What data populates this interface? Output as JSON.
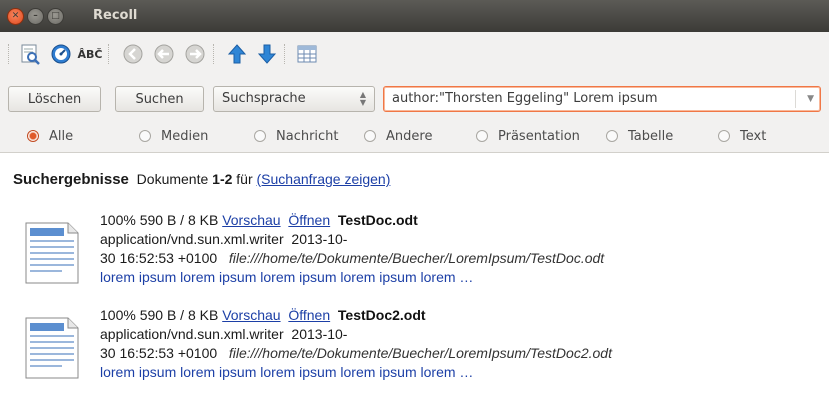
{
  "window": {
    "title": "Recoll"
  },
  "toolbar": {
    "icons": [
      "spell-check-icon",
      "query-icon",
      "ab-icon",
      "first-page-icon",
      "previous-page-icon",
      "next-page-icon",
      "sort-up-icon",
      "sort-down-icon",
      "table-view-icon"
    ],
    "abc_text": "ÂBČ"
  },
  "search": {
    "clear_label": "Löschen",
    "search_label": "Suchen",
    "language": "Suchsprache",
    "query": "author:\"Thorsten Eggeling\" Lorem ipsum"
  },
  "filters": [
    {
      "label": "Alle",
      "selected": true
    },
    {
      "label": "Medien",
      "selected": false
    },
    {
      "label": "Nachricht",
      "selected": false
    },
    {
      "label": "Andere",
      "selected": false
    },
    {
      "label": "Präsentation",
      "selected": false
    },
    {
      "label": "Tabelle",
      "selected": false
    },
    {
      "label": "Text",
      "selected": false
    }
  ],
  "results": {
    "heading": "Suchergebnisse",
    "count_prefix": "Dokumente",
    "range": "1-2",
    "for_word": "für",
    "show_query_link": "(Suchanfrage zeigen)",
    "items": [
      {
        "relevance": "100%",
        "size": "590 B / 8 KB",
        "preview": "Vorschau",
        "open": "Öffnen",
        "title": "TestDoc.odt",
        "mime": "application/vnd.sun.xml.writer",
        "date_part1": "2013-10-",
        "date_part2": "30 16:52:53 +0100",
        "path": "file:///home/te/Dokumente/Buecher/LoremIpsum/TestDoc.odt",
        "abstract": "lorem ipsum lorem ipsum lorem ipsum lorem ipsum lorem …"
      },
      {
        "relevance": "100%",
        "size": "590 B / 8 KB",
        "preview": "Vorschau",
        "open": "Öffnen",
        "title": "TestDoc2.odt",
        "mime": "application/vnd.sun.xml.writer",
        "date_part1": "2013-10-",
        "date_part2": "30 16:52:53 +0100",
        "path": "file:///home/te/Dokumente/Buecher/LoremIpsum/TestDoc2.odt",
        "abstract": "lorem ipsum lorem ipsum lorem ipsum lorem ipsum lorem …"
      }
    ]
  },
  "colors": {
    "accent": "#e05a2a",
    "link": "#1c3fa6",
    "titlebar": "#3c3b37"
  }
}
